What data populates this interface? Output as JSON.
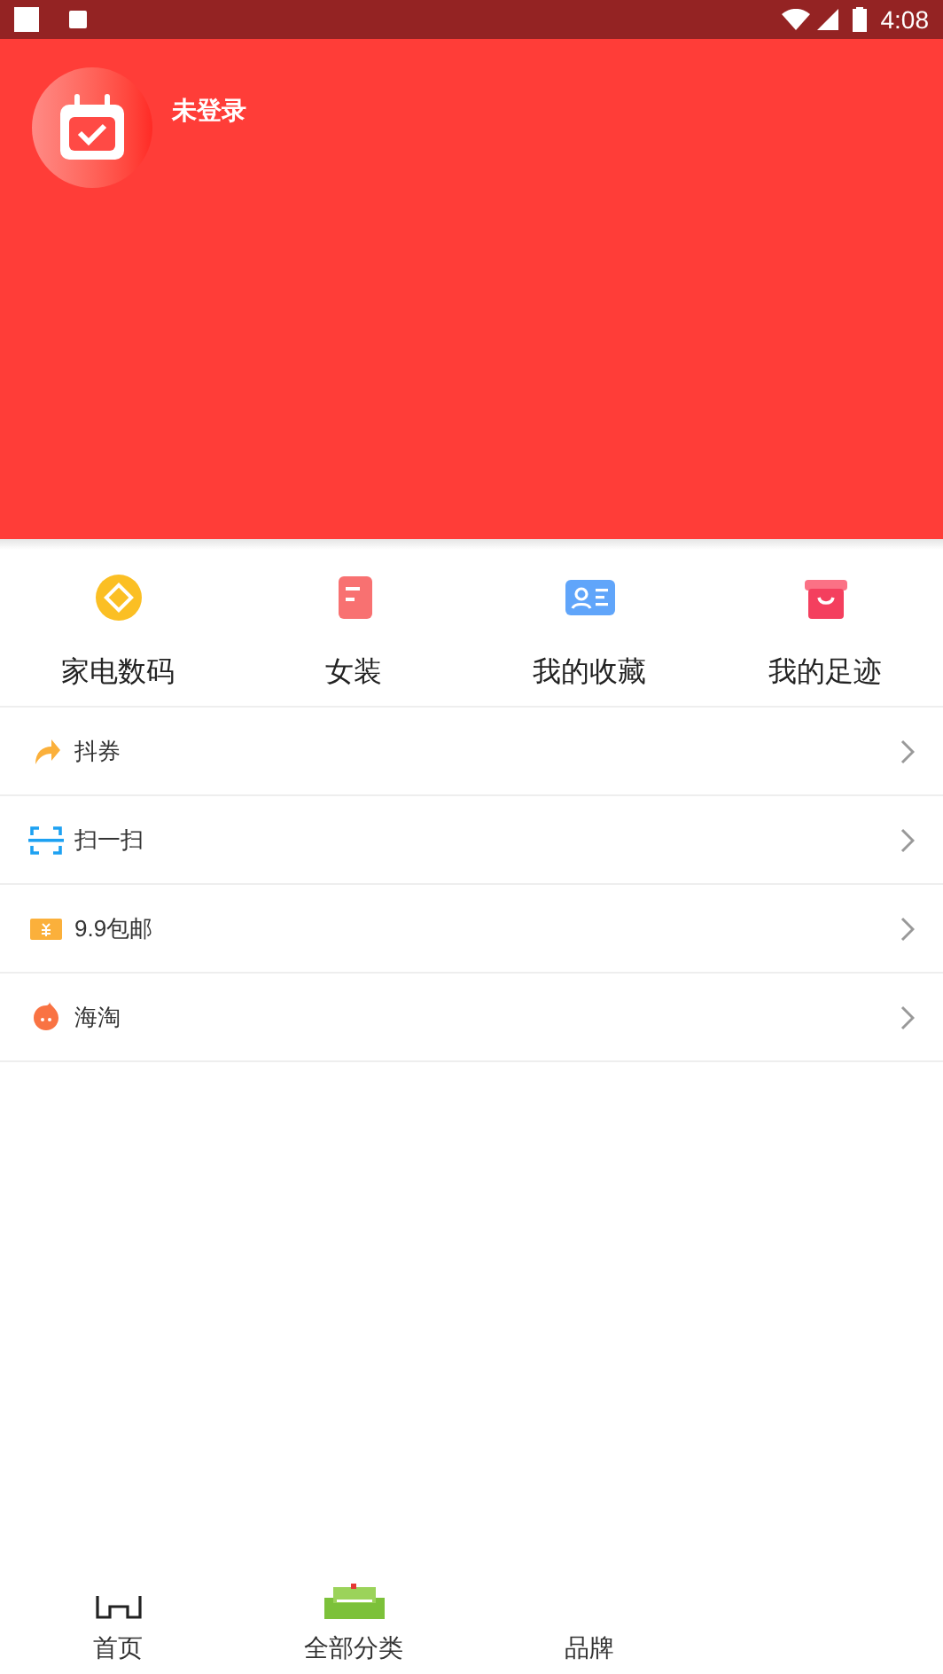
{
  "status_bar": {
    "time": "4:08"
  },
  "profile": {
    "name": "未登录"
  },
  "shortcuts": [
    {
      "kind": "coin",
      "label": "家电数码"
    },
    {
      "kind": "doc",
      "label": "女装"
    },
    {
      "kind": "card",
      "label": "我的收藏"
    },
    {
      "kind": "bag",
      "label": "我的足迹"
    }
  ],
  "menu": [
    {
      "kind": "share",
      "label": "抖券"
    },
    {
      "kind": "scan",
      "label": "扫一扫"
    },
    {
      "kind": "ticket",
      "label": "9.9包邮"
    },
    {
      "kind": "blob",
      "label": "海淘"
    }
  ],
  "tab_bar": [
    {
      "kind": "home",
      "label": "首页"
    },
    {
      "kind": "category",
      "label": "全部分类"
    },
    {
      "kind": "none",
      "label": "品牌"
    }
  ]
}
